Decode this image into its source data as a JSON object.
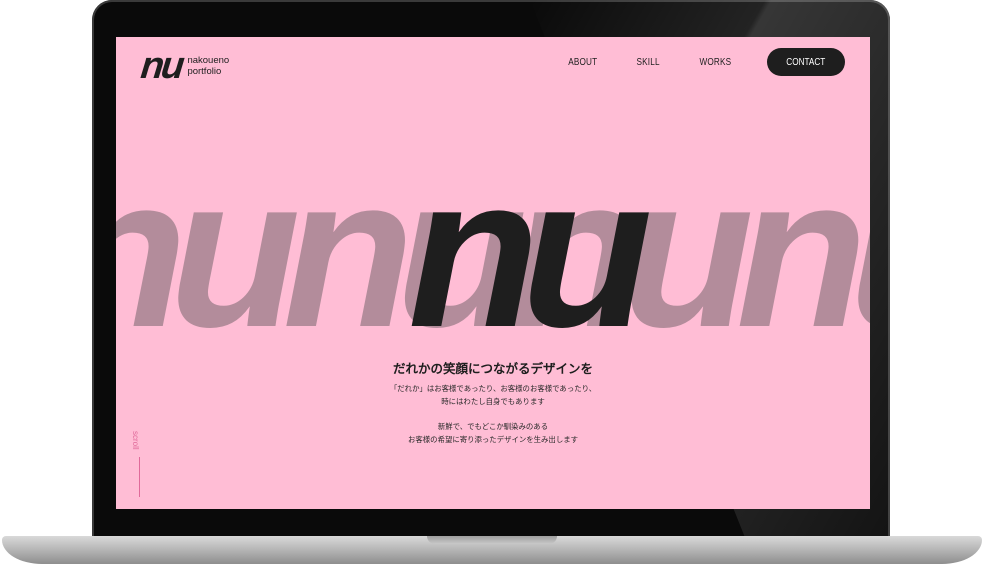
{
  "logo": {
    "mark": "nu",
    "line1": "nakoueno",
    "line2": "portfolio"
  },
  "nav": {
    "items": [
      "ABOUT",
      "SKILL",
      "WORKS"
    ],
    "contact": "CONTACT"
  },
  "hero": {
    "background_letters": "nunununununu",
    "center": "nu"
  },
  "copy": {
    "title": "だれかの笑顔につながるデザインを",
    "p1_line1": "「だれか」はお客様であったり、お客様のお客様であったり、",
    "p1_line2": "時にはわたし自身でもあります",
    "p2_line1": "新鮮で、でもどこか馴染みのある",
    "p2_line2": "お客様の希望に寄り添ったデザインを生み出します"
  },
  "scroll": {
    "label": "scroll"
  },
  "colors": {
    "background": "#ffbdd5",
    "accent_dark": "#1e1e1e",
    "muted_letters": "#b38c9b",
    "scroll_pink": "#e06a9a"
  }
}
